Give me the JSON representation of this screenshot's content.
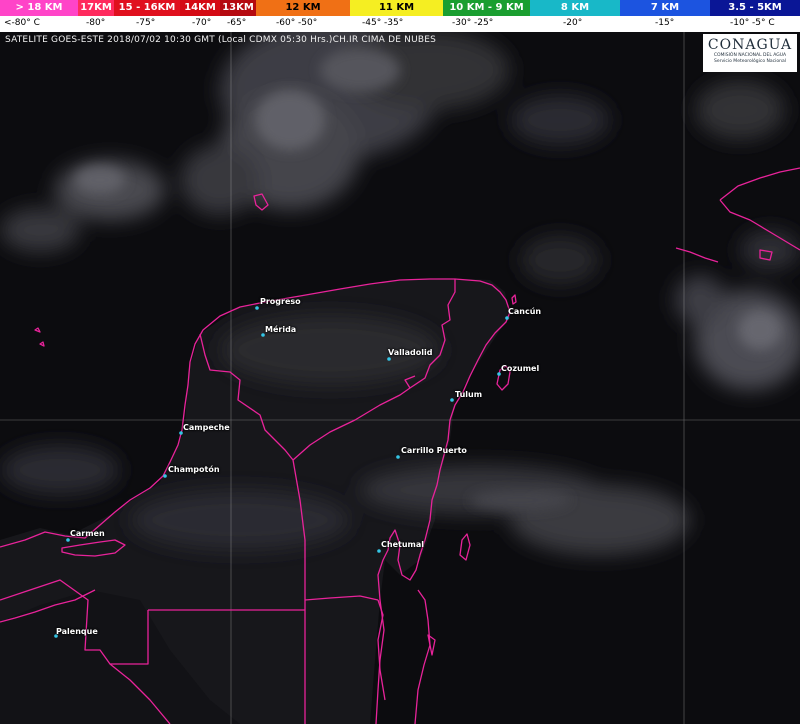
{
  "legend": {
    "bands": [
      {
        "label": "> 18 KM",
        "temp": "<-80° C",
        "color": "#ff44c8",
        "text_color": "#ffffff"
      },
      {
        "label": "17KM",
        "temp": "-80°",
        "color": "#ff2a5e",
        "text_color": "#ffffff"
      },
      {
        "label": "15 - 16KM",
        "temp": "-75°",
        "color": "#e0101e",
        "text_color": "#ffffff"
      },
      {
        "label": "14KM",
        "temp": "-70°",
        "color": "#d40a14",
        "text_color": "#ffffff"
      },
      {
        "label": "13KM",
        "temp": "-65°",
        "color": "#b50a10",
        "text_color": "#ffffff"
      },
      {
        "label": "12 KM",
        "temp": "-60°  -50°",
        "color": "#f07015",
        "text_color": "#000000"
      },
      {
        "label": "11 KM",
        "temp": "-45°    -35°",
        "color": "#f5ee22",
        "text_color": "#000000"
      },
      {
        "label": "10 KM  -  9 KM",
        "temp": "-30°  -25°",
        "color": "#1a9e30",
        "text_color": "#ffffff"
      },
      {
        "label": "8 KM",
        "temp": "-20°",
        "color": "#18b8c8",
        "text_color": "#ffffff"
      },
      {
        "label": "7 KM",
        "temp": "-15°",
        "color": "#1c54e0",
        "text_color": "#ffffff"
      },
      {
        "label": "3.5 - 5KM",
        "temp": "-10°   -5° C",
        "color": "#0a1696",
        "text_color": "#ffffff"
      }
    ]
  },
  "caption": "SATELITE GOES-ESTE 2018/07/02 10:30 GMT (Local CDMX 05:30 Hrs.)CH.IR CIMA DE NUBES",
  "logo": {
    "name": "CONAGUA",
    "sub1": "COMISIÓN NACIONAL DEL AGUA",
    "sub2": "Servicio Meteorológico Nacional"
  },
  "cities": [
    {
      "name": "Progreso"
    },
    {
      "name": "Mérida"
    },
    {
      "name": "Valladolid"
    },
    {
      "name": "Cancún"
    },
    {
      "name": "Cozumel"
    },
    {
      "name": "Tulum"
    },
    {
      "name": "Campeche"
    },
    {
      "name": "Champotón"
    },
    {
      "name": "Carrillo Puerto"
    },
    {
      "name": "Carmen"
    },
    {
      "name": "Chetumal"
    },
    {
      "name": "Palenque"
    }
  ],
  "colors": {
    "border": "#e8239a",
    "city_dot": "#34c6e6",
    "grid": "#b8b8b8"
  }
}
